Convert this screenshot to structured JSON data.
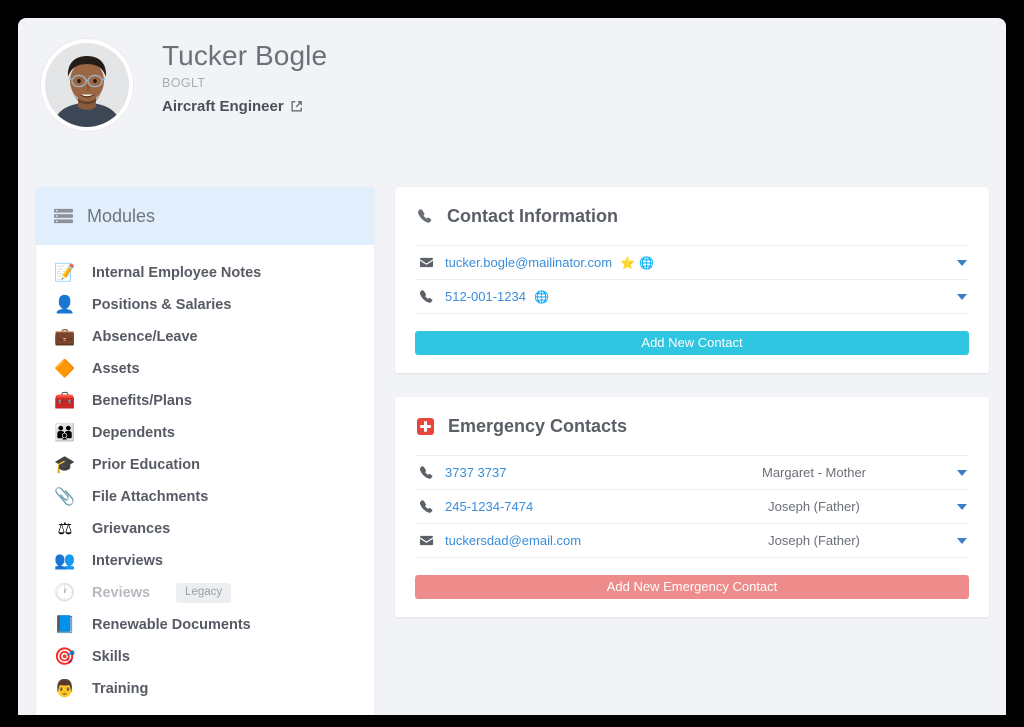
{
  "profile": {
    "name": "Tucker Bogle",
    "code": "BOGLT",
    "job_title": "Aircraft Engineer",
    "link_icon": "external-link-icon",
    "avatar_alt": "employee-photo"
  },
  "sidebar": {
    "header": {
      "icon": "server-stack-icon",
      "title": "Modules"
    },
    "items": [
      {
        "icon": "note-icon",
        "emoji": "📝",
        "label": "Internal Employee Notes",
        "disabled": false,
        "badge": ""
      },
      {
        "icon": "person-icon",
        "emoji": "👤",
        "label": "Positions & Salaries",
        "disabled": false,
        "badge": ""
      },
      {
        "icon": "briefcase-icon",
        "emoji": "💼",
        "label": "Absence/Leave",
        "disabled": false,
        "badge": ""
      },
      {
        "icon": "shapes-icon",
        "emoji": "🔶",
        "label": "Assets",
        "disabled": false,
        "badge": ""
      },
      {
        "icon": "toolbox-icon",
        "emoji": "🧰",
        "label": "Benefits/Plans",
        "disabled": false,
        "badge": ""
      },
      {
        "icon": "family-icon",
        "emoji": "👪",
        "label": "Dependents",
        "disabled": false,
        "badge": ""
      },
      {
        "icon": "graduation-cap-icon",
        "emoji": "🎓",
        "label": "Prior Education",
        "disabled": false,
        "badge": ""
      },
      {
        "icon": "paperclip-file-icon",
        "emoji": "📎",
        "label": "File Attachments",
        "disabled": false,
        "badge": ""
      },
      {
        "icon": "gavel-icon",
        "emoji": "⚖",
        "label": "Grievances",
        "disabled": false,
        "badge": ""
      },
      {
        "icon": "people-icon",
        "emoji": "👥",
        "label": "Interviews",
        "disabled": false,
        "badge": ""
      },
      {
        "icon": "clock-icon",
        "emoji": "🕐",
        "label": "Reviews",
        "disabled": true,
        "badge": "Legacy"
      },
      {
        "icon": "certificate-icon",
        "emoji": "📘",
        "label": "Renewable Documents",
        "disabled": false,
        "badge": ""
      },
      {
        "icon": "target-icon",
        "emoji": "🎯",
        "label": "Skills",
        "disabled": false,
        "badge": ""
      },
      {
        "icon": "presenter-icon",
        "emoji": "👨",
        "label": "Training",
        "disabled": false,
        "badge": ""
      }
    ]
  },
  "contact_information": {
    "header": {
      "icon": "phone-icon",
      "title": "Contact Information"
    },
    "rows": [
      {
        "type_icon": "envelope-icon",
        "value": "tucker.bogle@mailinator.com",
        "flags": [
          "⭐",
          "🌐"
        ],
        "caret": "chevron-down-icon"
      },
      {
        "type_icon": "phone-icon",
        "value": "512-001-1234",
        "flags": [
          "🌐"
        ],
        "caret": "chevron-down-icon"
      }
    ],
    "action_label": "Add New Contact",
    "action_color": "#2ec6e0"
  },
  "emergency_contacts": {
    "header": {
      "icon": "medical-cross-icon",
      "title": "Emergency Contacts"
    },
    "rows": [
      {
        "type_icon": "phone-icon",
        "value": "3737 3737",
        "relation": "Margaret - Mother",
        "caret": "chevron-down-icon"
      },
      {
        "type_icon": "phone-icon",
        "value": "245-1234-7474",
        "relation": "Joseph (Father)",
        "caret": "chevron-down-icon"
      },
      {
        "type_icon": "envelope-icon",
        "value": "tuckersdad@email.com",
        "relation": "Joseph (Father)",
        "caret": "chevron-down-icon"
      }
    ],
    "action_label": "Add New Emergency Contact",
    "action_color": "#ee8b8b"
  },
  "theme": {
    "page_bg": "#f2f3f7",
    "card_bg": "#ffffff",
    "sidebar_header_bg": "#e1eefb",
    "link_blue": "#3a8ddb",
    "accent_cyan": "#2ec6e0",
    "accent_salmon": "#ee8b8b",
    "emergency_red": "#e8453c"
  }
}
